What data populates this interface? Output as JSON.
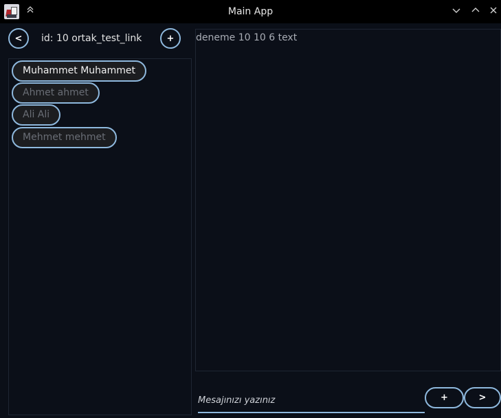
{
  "window": {
    "title": "Main App",
    "keep_above_icon": "double-chevron-up-icon",
    "controls": {
      "minimize": "∨",
      "maximize": "∧",
      "close": "✕"
    }
  },
  "header": {
    "back_label": "<",
    "chat_id": "id: 10 ortak_test_link",
    "add_label": "+"
  },
  "users": [
    {
      "name": "Muhammet Muhammet",
      "active": true
    },
    {
      "name": "Ahmet ahmet",
      "active": false
    },
    {
      "name": "Ali Ali",
      "active": false
    },
    {
      "name": "Mehmet mehmet",
      "active": false
    }
  ],
  "messages": [
    {
      "text": "deneme 10 10 6 text"
    }
  ],
  "composer": {
    "placeholder": "Mesajınızı yazınız",
    "attach_label": "+",
    "send_label": ">"
  },
  "colors": {
    "background": "#0b0f18",
    "accent_border": "#8fb9de",
    "pill_fill": "#1c1d20",
    "inactive_text": "#6a6e76"
  }
}
